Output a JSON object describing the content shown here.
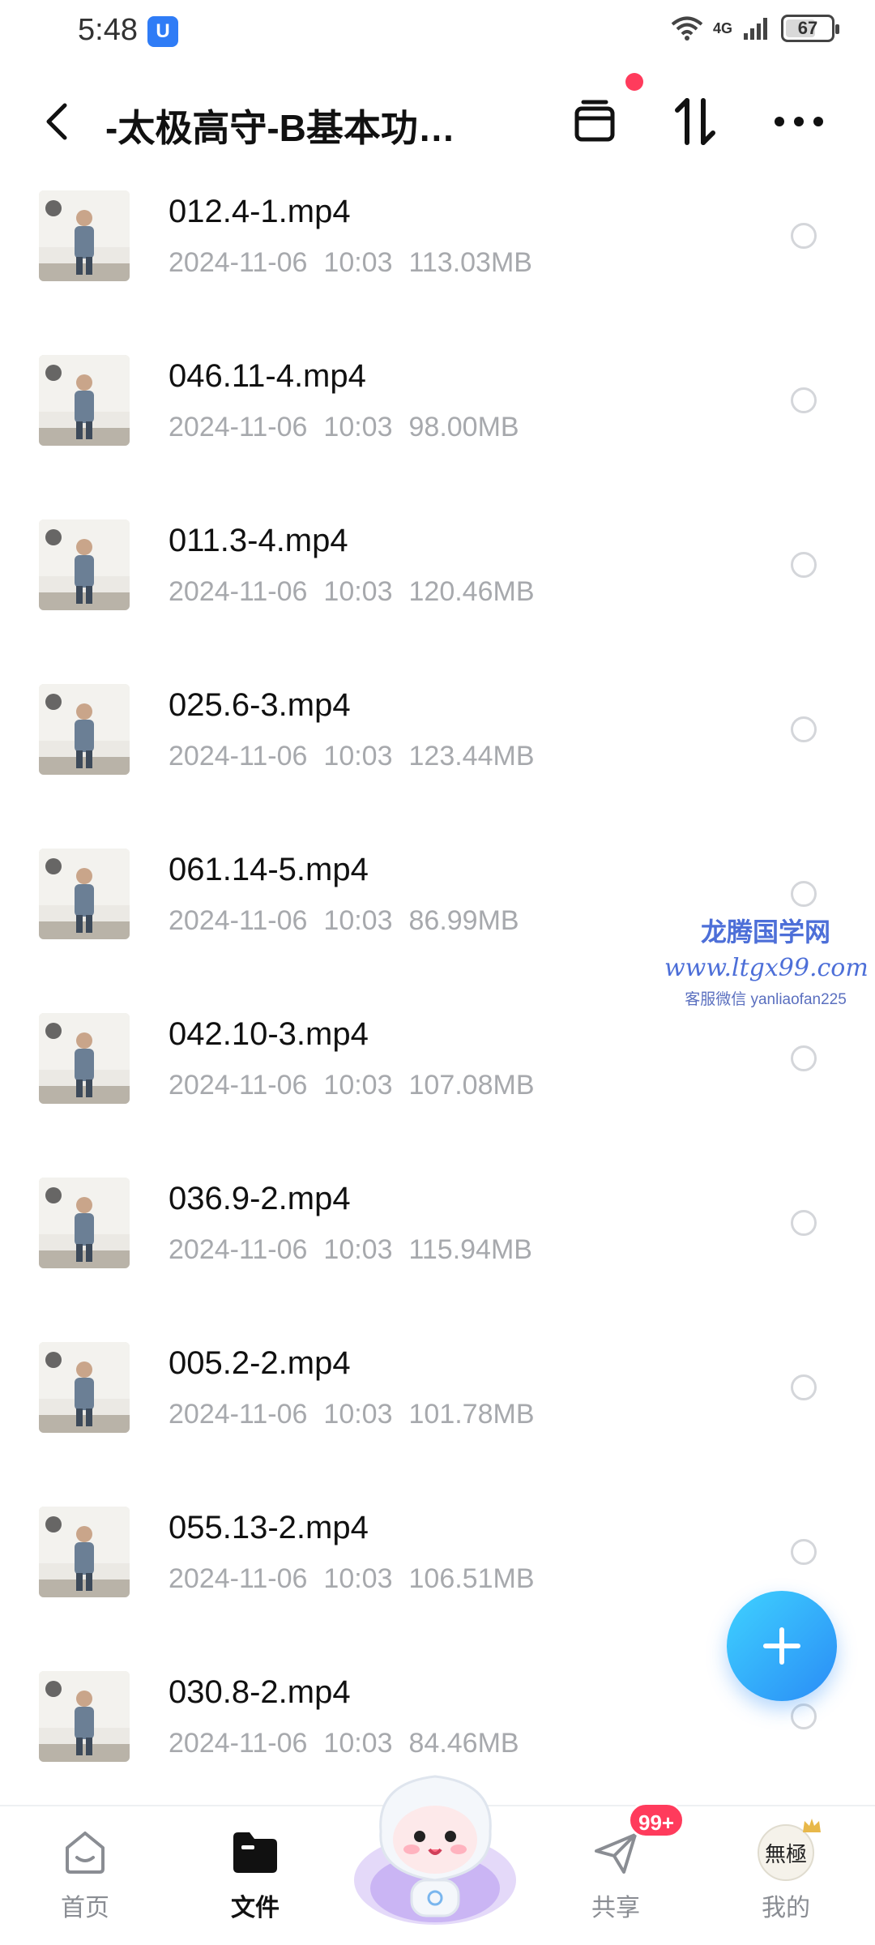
{
  "status_bar": {
    "time": "5:48",
    "app_icon_glyph": "U",
    "network": "4G",
    "battery_level": 67,
    "battery_text": "67"
  },
  "header": {
    "title": "-太极高守-B基本功…",
    "icons": [
      "back-arrow-icon",
      "archive-box-icon",
      "sort-icon",
      "more-dots-icon"
    ]
  },
  "files": [
    {
      "name": "012.4-1.mp4",
      "date": "2024-11-06",
      "time": "10:03",
      "size": "113.03MB"
    },
    {
      "name": "046.11-4.mp4",
      "date": "2024-11-06",
      "time": "10:03",
      "size": "98.00MB"
    },
    {
      "name": "011.3-4.mp4",
      "date": "2024-11-06",
      "time": "10:03",
      "size": "120.46MB"
    },
    {
      "name": "025.6-3.mp4",
      "date": "2024-11-06",
      "time": "10:03",
      "size": "123.44MB"
    },
    {
      "name": "061.14-5.mp4",
      "date": "2024-11-06",
      "time": "10:03",
      "size": "86.99MB"
    },
    {
      "name": "042.10-3.mp4",
      "date": "2024-11-06",
      "time": "10:03",
      "size": "107.08MB"
    },
    {
      "name": "036.9-2.mp4",
      "date": "2024-11-06",
      "time": "10:03",
      "size": "115.94MB"
    },
    {
      "name": "005.2-2.mp4",
      "date": "2024-11-06",
      "time": "10:03",
      "size": "101.78MB"
    },
    {
      "name": "055.13-2.mp4",
      "date": "2024-11-06",
      "time": "10:03",
      "size": "106.51MB"
    },
    {
      "name": "030.8-2.mp4",
      "date": "2024-11-06",
      "time": "10:03",
      "size": "84.46MB"
    }
  ],
  "watermark": {
    "line1": "龙腾国学网",
    "line2": "www.ltgx99.com",
    "line3": "客服微信 yanliaofan225"
  },
  "bottom_nav": {
    "home": "首页",
    "files": "文件",
    "share": "共享",
    "share_badge": "99+",
    "mine": "我的",
    "avatar_text": "無極"
  },
  "colors": {
    "accent": "#2a8cf6",
    "badge": "#ff3b5c",
    "meta_text": "#a7a9ad"
  }
}
